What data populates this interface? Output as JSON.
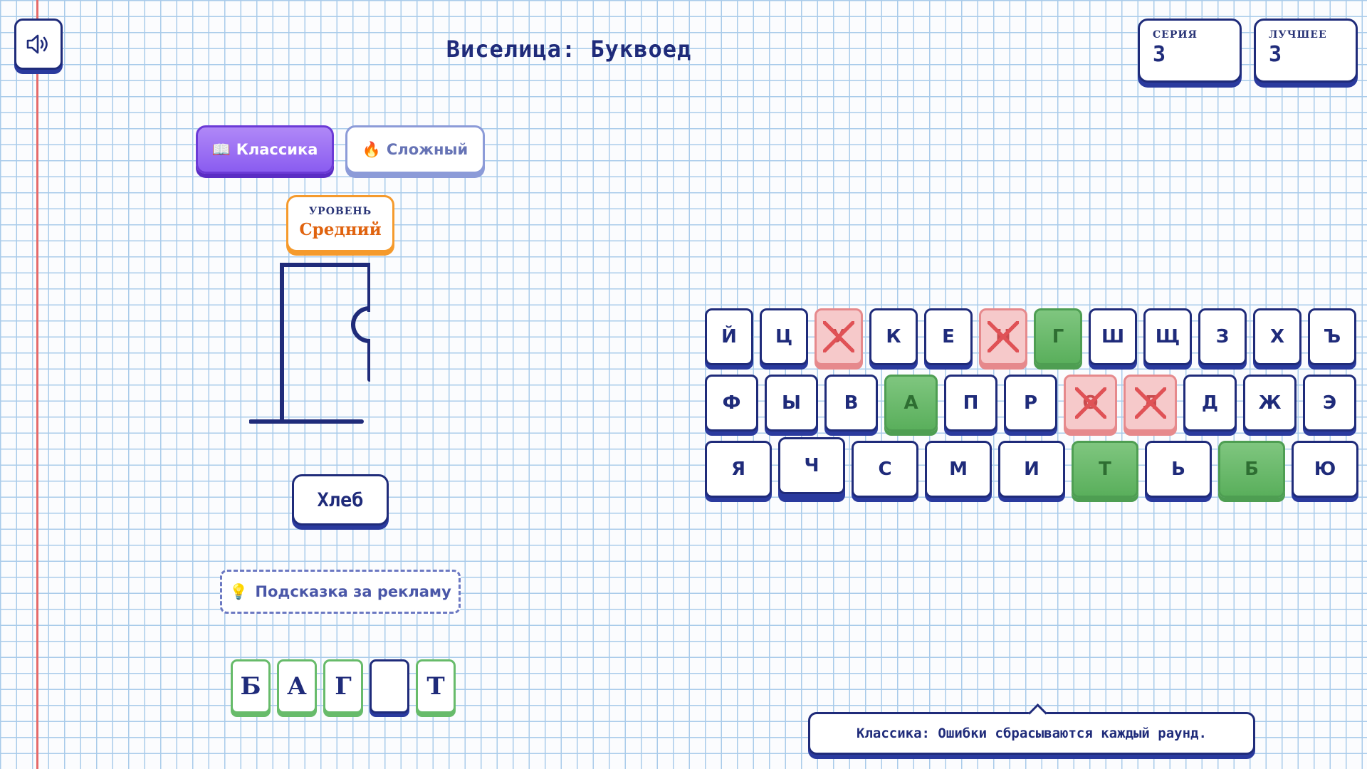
{
  "game": {
    "title": "Виселица: Буквоед"
  },
  "stats": {
    "series_label": "СЕРИЯ",
    "series_value": "3",
    "best_label": "ЛУЧШЕЕ",
    "best_value": "3"
  },
  "modes": {
    "classic_icon": "📖",
    "classic_label": "Классика",
    "hard_icon": "🔥",
    "hard_label": "Сложный",
    "selected": "classic"
  },
  "level": {
    "label": "УРОВЕНЬ",
    "value": "Средний"
  },
  "hangman": {
    "parts_shown": [
      "base",
      "pole",
      "beam",
      "rope",
      "head",
      "body"
    ]
  },
  "hint": {
    "word_hint": "Хлеб",
    "ad_icon": "💡",
    "ad_label": "Подсказка за рекламу"
  },
  "word": {
    "slots": [
      "Б",
      "А",
      "Г",
      "",
      "Т"
    ]
  },
  "keyboard": {
    "rows": [
      [
        {
          "letter": "Й",
          "state": "unused"
        },
        {
          "letter": "Ц",
          "state": "unused"
        },
        {
          "letter": "У",
          "state": "wrong"
        },
        {
          "letter": "К",
          "state": "unused"
        },
        {
          "letter": "Е",
          "state": "unused"
        },
        {
          "letter": "Н",
          "state": "wrong"
        },
        {
          "letter": "Г",
          "state": "correct"
        },
        {
          "letter": "Ш",
          "state": "unused"
        },
        {
          "letter": "Щ",
          "state": "unused"
        },
        {
          "letter": "З",
          "state": "unused"
        },
        {
          "letter": "Х",
          "state": "unused"
        },
        {
          "letter": "Ъ",
          "state": "unused"
        }
      ],
      [
        {
          "letter": "Ф",
          "state": "unused"
        },
        {
          "letter": "Ы",
          "state": "unused"
        },
        {
          "letter": "В",
          "state": "unused"
        },
        {
          "letter": "А",
          "state": "correct"
        },
        {
          "letter": "П",
          "state": "unused"
        },
        {
          "letter": "Р",
          "state": "unused"
        },
        {
          "letter": "О",
          "state": "wrong"
        },
        {
          "letter": "Л",
          "state": "wrong"
        },
        {
          "letter": "Д",
          "state": "unused"
        },
        {
          "letter": "Ж",
          "state": "unused"
        },
        {
          "letter": "Э",
          "state": "unused"
        }
      ],
      [
        {
          "letter": "Я",
          "state": "unused"
        },
        {
          "letter": "Ч",
          "state": "hover"
        },
        {
          "letter": "С",
          "state": "unused"
        },
        {
          "letter": "М",
          "state": "unused"
        },
        {
          "letter": "И",
          "state": "unused"
        },
        {
          "letter": "Т",
          "state": "correct"
        },
        {
          "letter": "Ь",
          "state": "unused"
        },
        {
          "letter": "Б",
          "state": "correct"
        },
        {
          "letter": "Ю",
          "state": "unused"
        }
      ]
    ]
  },
  "tooltip": {
    "text": "Классика: Ошибки сбрасываются каждый раунд."
  },
  "colors": {
    "ink": "#1f2b7a",
    "correct": "#5aaf5c",
    "wrong": "#e05256",
    "accent": "#8a5cf0",
    "level": "#e0630f"
  }
}
